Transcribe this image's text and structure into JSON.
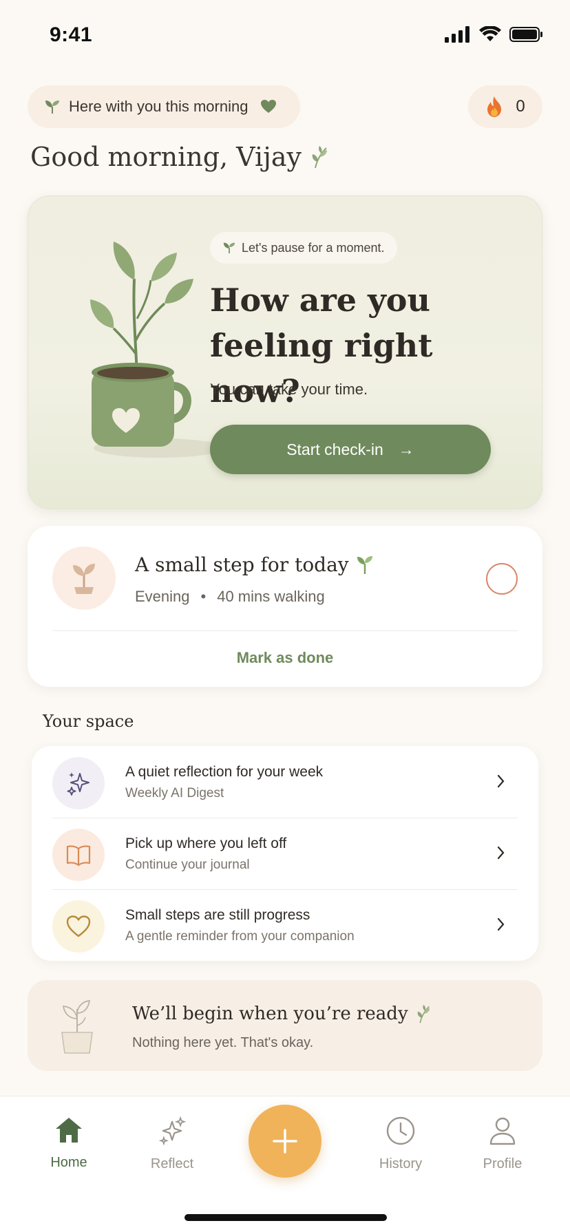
{
  "status_bar": {
    "time": "9:41"
  },
  "header": {
    "greeting_pill": "Here with you this morning",
    "streak_count": "0",
    "greeting": "Good morning, Vijay"
  },
  "hero": {
    "pause_label": "Let's pause for a moment.",
    "title": "How are you feeling right now?",
    "subtitle": "You can take your time.",
    "button_label": "Start check-in",
    "button_arrow": "→"
  },
  "step": {
    "title": "A small step for today",
    "time": "Evening",
    "separator": "•",
    "activity": "40 mins walking",
    "action": "Mark as done"
  },
  "space": {
    "title": "Your space",
    "items": [
      {
        "title": "A quiet reflection for your week",
        "subtitle": "Weekly AI Digest",
        "icon": "sparkle-icon",
        "bg": "#F1EEF6",
        "color": "#5C4D78"
      },
      {
        "title": "Pick up where you left off",
        "subtitle": "Continue your journal",
        "icon": "book-icon",
        "bg": "#FBEADF",
        "color": "#D98A55"
      },
      {
        "title": "Small steps are still progress",
        "subtitle": "A gentle reminder from your companion",
        "icon": "heart-icon",
        "bg": "#FAF3DE",
        "color": "#B88A3A"
      }
    ]
  },
  "empty": {
    "title": "We’ll begin when you’re ready",
    "subtitle": "Nothing here yet. That's okay."
  },
  "tabs": {
    "home": "Home",
    "reflect": "Reflect",
    "history": "History",
    "profile": "Profile",
    "active": "home"
  },
  "colors": {
    "accent_green": "#6F8A5C",
    "fab_orange": "#F0B35A",
    "background": "#FCF9F4"
  }
}
